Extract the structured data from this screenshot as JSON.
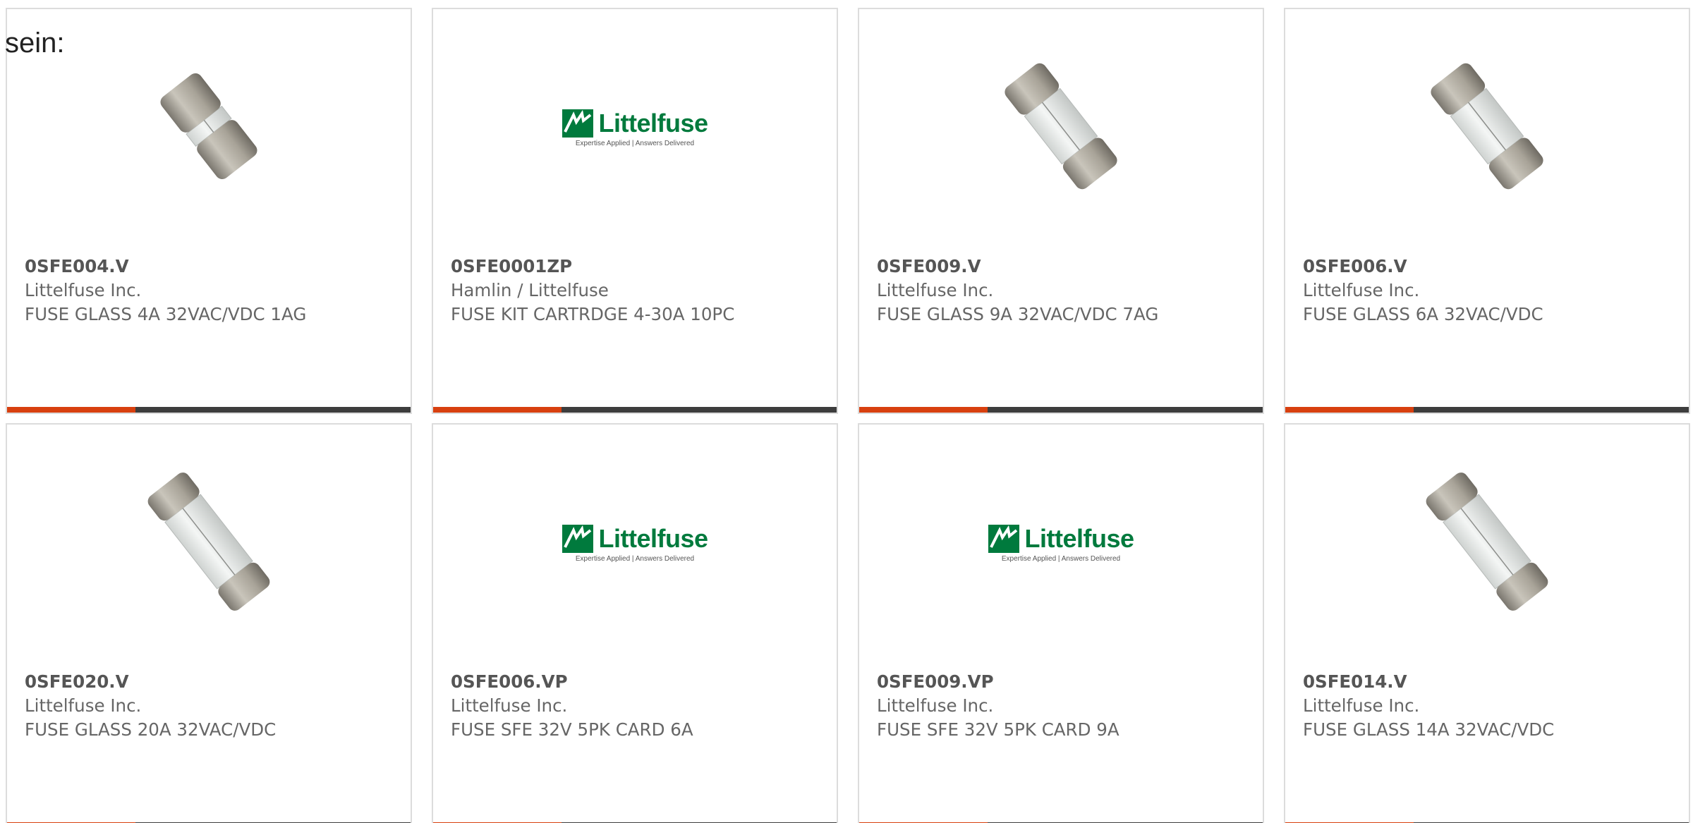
{
  "intro_text": "sein:",
  "accent_color": "#d8400f",
  "bar_color": "#3d3d3d",
  "products": [
    {
      "part": "0SFE004.V",
      "maker": "Littelfuse Inc.",
      "desc": "FUSE GLASS 4A 32VAC/VDC 1AG",
      "image": "fuse-short"
    },
    {
      "part": "0SFE0001ZP",
      "maker": "Hamlin / Littelfuse",
      "desc": "FUSE KIT CARTRDGE 4-30A 10PC",
      "image": "littelfuse-logo"
    },
    {
      "part": "0SFE009.V",
      "maker": "Littelfuse Inc.",
      "desc": "FUSE GLASS 9A 32VAC/VDC 7AG",
      "image": "fuse-medium"
    },
    {
      "part": "0SFE006.V",
      "maker": "Littelfuse Inc.",
      "desc": "FUSE GLASS 6A 32VAC/VDC",
      "image": "fuse-medium"
    },
    {
      "part": "0SFE020.V",
      "maker": "Littelfuse Inc.",
      "desc": "FUSE GLASS 20A 32VAC/VDC",
      "image": "fuse-long"
    },
    {
      "part": "0SFE006.VP",
      "maker": "Littelfuse Inc.",
      "desc": "FUSE SFE 32V 5PK CARD 6A",
      "image": "littelfuse-logo"
    },
    {
      "part": "0SFE009.VP",
      "maker": "Littelfuse Inc.",
      "desc": "FUSE SFE 32V 5PK CARD 9A",
      "image": "littelfuse-logo"
    },
    {
      "part": "0SFE014.V",
      "maker": "Littelfuse Inc.",
      "desc": "FUSE GLASS 14A 32VAC/VDC",
      "image": "fuse-long"
    }
  ],
  "logo": {
    "word": "Littelfuse",
    "tagline": "Expertise Applied | Answers Delivered"
  }
}
